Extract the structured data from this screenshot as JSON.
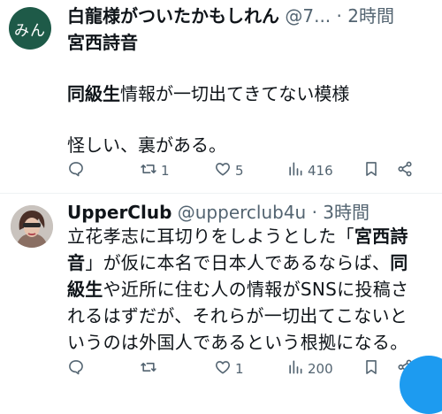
{
  "tweets": [
    {
      "avatar_text": "みん",
      "display_name": "白龍様がついたかもしれん",
      "handle": "@7...",
      "time": "· 2時間",
      "body": [
        [
          {
            "t": "宮西詩音",
            "b": true
          }
        ],
        [],
        [
          {
            "t": "同級生",
            "b": true
          },
          {
            "t": "情報が一切出てきてない模様",
            "b": false
          }
        ],
        [],
        [
          {
            "t": "怪しい、裏がある。",
            "b": false
          }
        ]
      ],
      "replies": "",
      "retweets": "1",
      "likes": "5",
      "views": "416"
    },
    {
      "display_name": "UpperClub",
      "handle": "@upperclub4u",
      "time": "· 3時間",
      "body": [
        [
          {
            "t": "立花孝志に耳切りをしようとした「",
            "b": false
          },
          {
            "t": "宮西詩",
            "b": true
          }
        ],
        [
          {
            "t": "音",
            "b": true
          },
          {
            "t": "」が仮に本名で日本人であるならば、",
            "b": false
          },
          {
            "t": "同",
            "b": true
          }
        ],
        [
          {
            "t": "級生",
            "b": true
          },
          {
            "t": "や近所に住む人の情報がSNSに投稿さ",
            "b": false
          }
        ],
        [
          {
            "t": "れるはずだが、それらが一切出てこないと",
            "b": false
          }
        ],
        [
          {
            "t": "いうのは外国人であるという根拠になる。",
            "b": false
          }
        ]
      ],
      "replies": "",
      "retweets": "",
      "likes": "1",
      "views": "200"
    }
  ],
  "icons": [
    "reply-icon",
    "retweet-icon",
    "like-icon",
    "views-icon",
    "bookmark-icon",
    "share-icon"
  ],
  "colors": {
    "text": "#0f1419",
    "meta": "#536471",
    "accent": "#1d9bf0",
    "avatar_bg": "#1e5a48"
  }
}
